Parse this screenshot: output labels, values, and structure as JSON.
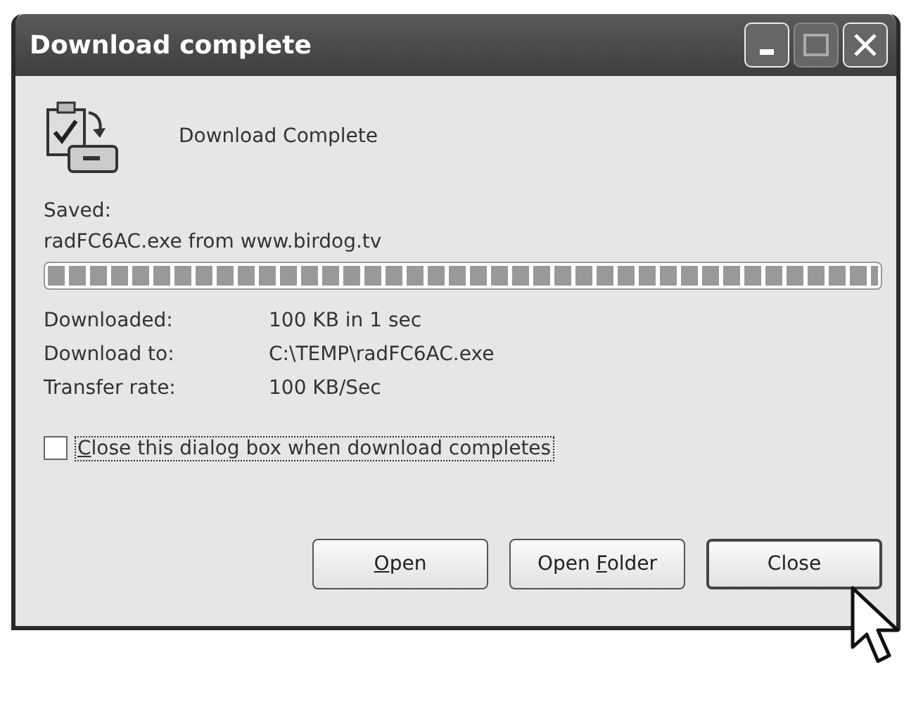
{
  "window": {
    "title": "Download complete",
    "controls": [
      {
        "kind": "minimize",
        "disabled": false
      },
      {
        "kind": "maximize",
        "disabled": true
      },
      {
        "kind": "close",
        "disabled": false
      }
    ]
  },
  "heading": "Download Complete",
  "saved_label": "Saved:",
  "saved_file": "radFC6AC.exe from www.birdog.tv",
  "progress": {
    "level": 1
  },
  "details": [
    {
      "label": "Downloaded:",
      "value": "100 KB in 1 sec"
    },
    {
      "label": "Download to:",
      "value": "C:\\TEMP\\radFC6AC.exe"
    },
    {
      "label": "Transfer rate:",
      "value": "100 KB/Sec"
    }
  ],
  "close_when_done": {
    "key": "C",
    "rest": "lose this dialog box when download completes",
    "checked": false,
    "focused": true
  },
  "buttons": [
    {
      "key": "O",
      "rest": "pen",
      "default": false
    },
    {
      "pre": "Open ",
      "key": "F",
      "rest": "older",
      "default": false
    },
    {
      "pre": "Close",
      "default": true
    }
  ]
}
